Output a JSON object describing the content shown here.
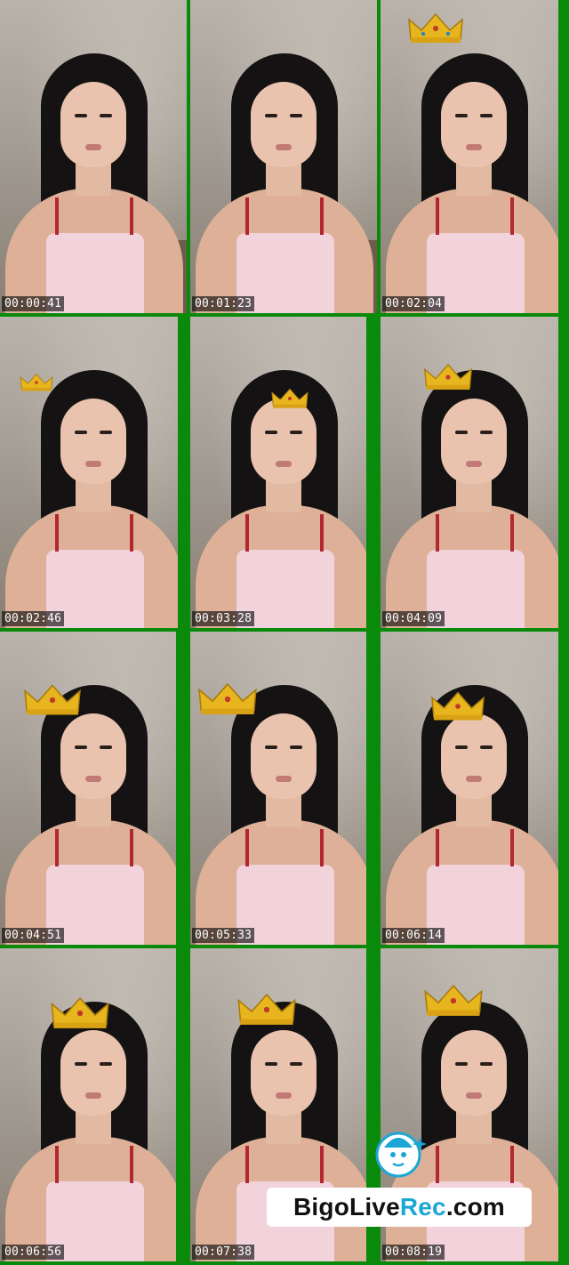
{
  "timestamps": [
    "00:00:41",
    "00:01:23",
    "00:02:04",
    "00:02:46",
    "00:03:28",
    "00:04:09",
    "00:04:51",
    "00:05:33",
    "00:06:14",
    "00:06:56",
    "00:07:38",
    "00:08:19"
  ],
  "crowns": [
    false,
    false,
    true,
    true,
    true,
    true,
    true,
    true,
    true,
    true,
    true,
    true
  ],
  "watermark": {
    "prefix": "BigoLive",
    "accent": "Rec",
    "suffix": ".com"
  },
  "colors": {
    "background": "#0a8a0a",
    "accent": "#1aa7d6",
    "crown": "#e7b51e"
  }
}
